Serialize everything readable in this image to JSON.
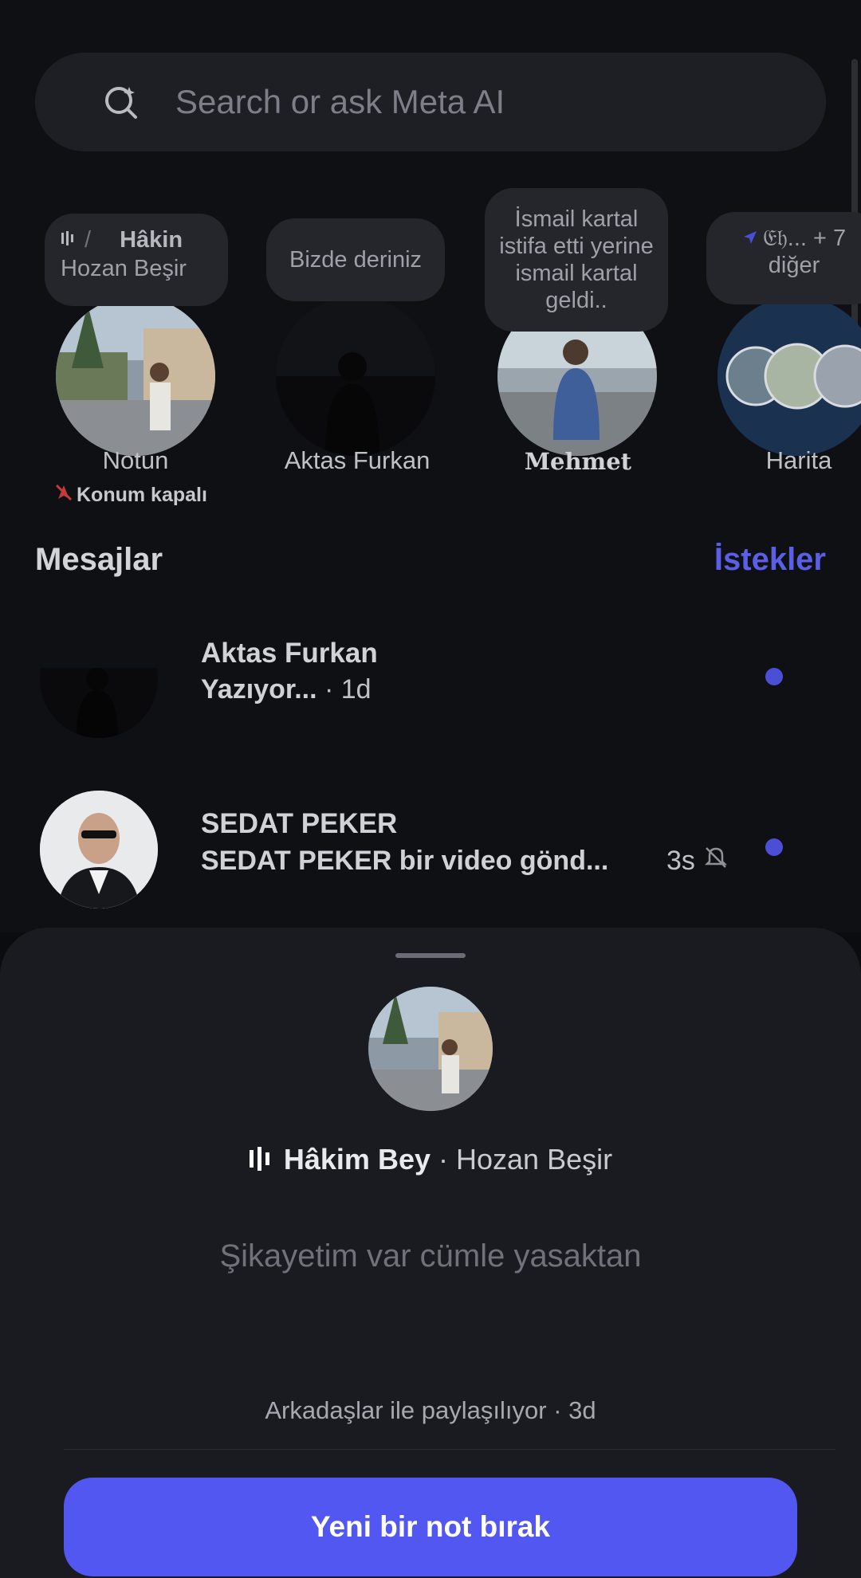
{
  "search": {
    "placeholder": "Search or ask Meta AI",
    "icon": "meta-ai-search-icon"
  },
  "notes": [
    {
      "bubble_line1": "Hâkin",
      "bubble_line2": "Hozan Beşir",
      "name": "Notun",
      "sub": "Konum kapalı"
    },
    {
      "bubble": "Bizde deriniz",
      "name": "Aktas Furkan"
    },
    {
      "bubble": "İsmail kartal istifa etti yerine ismail kartal geldi..",
      "name": "Mehmet"
    },
    {
      "bubble_line1": "𝔈𝔥... + 7",
      "bubble_line2": "diğer",
      "name": "Harita"
    }
  ],
  "section": {
    "title": "Mesajlar",
    "requests": "İstekler"
  },
  "messages": [
    {
      "name": "Aktas Furkan",
      "preview": "Yazıyor...",
      "time": " · 1d",
      "unread": true
    },
    {
      "name": "SEDAT PEKER",
      "preview": "SEDAT PEKER bir video gönd...",
      "time": "3s",
      "muted": true,
      "unread": true
    }
  ],
  "sheet": {
    "song_title": "Hâkim Bey",
    "song_sep": " · ",
    "artist": "Hozan Beşir",
    "note_text": "Şikayetim var cümle yasaktan",
    "shared": "Arkadaşlar ile paylaşılıyor · 3d",
    "cta": "Yeni bir not bırak"
  },
  "colors": {
    "accent": "#5157f0",
    "requests": "#5b5ee6",
    "background": "#0b0c0f",
    "sheet": "#1a1b20"
  }
}
